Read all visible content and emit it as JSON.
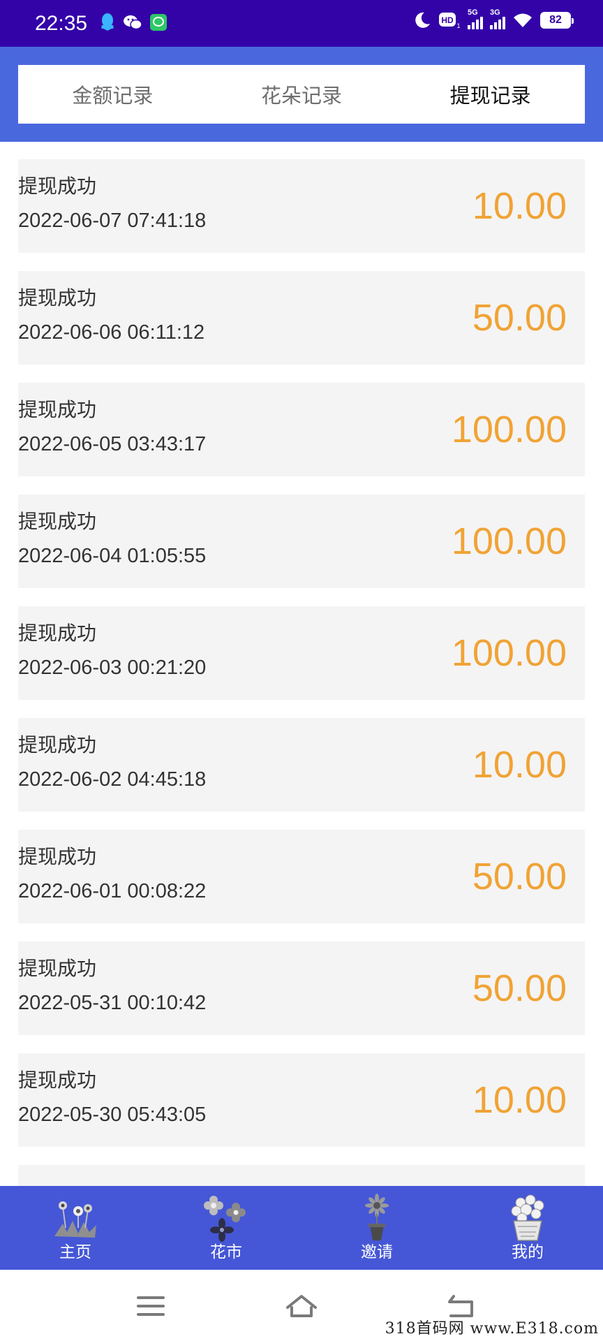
{
  "status_bar": {
    "time": "22:35",
    "network_5g": "5G",
    "network_3g": "3G",
    "hd": "HD",
    "battery": "82",
    "icons": [
      "qq-icon",
      "wechat-icon",
      "message-icon",
      "moon-icon",
      "hd-icon",
      "signal-icon",
      "wifi-icon",
      "battery-icon"
    ]
  },
  "tabs": [
    {
      "label": "金额记录",
      "active": false
    },
    {
      "label": "花朵记录",
      "active": false
    },
    {
      "label": "提现记录",
      "active": true
    }
  ],
  "records": [
    {
      "status": "提现成功",
      "date": "2022-06-07 07:41:18",
      "amount": "10.00"
    },
    {
      "status": "提现成功",
      "date": "2022-06-06 06:11:12",
      "amount": "50.00"
    },
    {
      "status": "提现成功",
      "date": "2022-06-05 03:43:17",
      "amount": "100.00"
    },
    {
      "status": "提现成功",
      "date": "2022-06-04 01:05:55",
      "amount": "100.00"
    },
    {
      "status": "提现成功",
      "date": "2022-06-03 00:21:20",
      "amount": "100.00"
    },
    {
      "status": "提现成功",
      "date": "2022-06-02 04:45:18",
      "amount": "10.00"
    },
    {
      "status": "提现成功",
      "date": "2022-06-01 00:08:22",
      "amount": "50.00"
    },
    {
      "status": "提现成功",
      "date": "2022-05-31 00:10:42",
      "amount": "50.00"
    },
    {
      "status": "提现成功",
      "date": "2022-05-30 05:43:05",
      "amount": "10.00"
    }
  ],
  "bottom_nav": [
    {
      "label": "主页",
      "icon": "flowers-grass-icon"
    },
    {
      "label": "花市",
      "icon": "flower-market-icon"
    },
    {
      "label": "邀请",
      "icon": "potted-flower-icon"
    },
    {
      "label": "我的",
      "icon": "flower-basket-icon"
    }
  ],
  "watermark": "318首码网  www.E318.com",
  "colors": {
    "status_bar": "#3303a8",
    "header": "#4a68de",
    "bottom_nav": "#4557d6",
    "amount": "#f0a335",
    "row_bg": "#f4f4f4"
  }
}
